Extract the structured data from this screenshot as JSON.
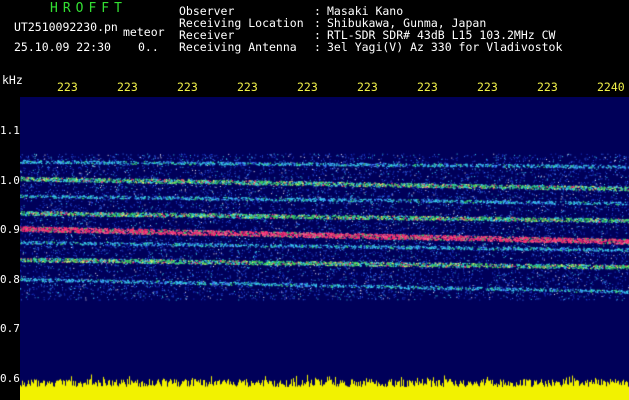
{
  "app": {
    "title": "HROFFT"
  },
  "file": {
    "name": "UT2510092230.pn",
    "type": "meteor"
  },
  "capture": {
    "datetime": "25.10.09 22:30",
    "count": "0.."
  },
  "station": [
    {
      "key": "Observer",
      "value": "Masaki Kano"
    },
    {
      "key": "Receiving Location",
      "value": "Shibukawa, Gunma, Japan"
    },
    {
      "key": "Receiver",
      "value": "RTL-SDR SDR# 43dB L15 103.2MHz CW"
    },
    {
      "key": "Receiving Antenna",
      "value": "3el Yagi(V) Az 330 for Vladivostok"
    }
  ],
  "axis": {
    "y_unit": "kHz",
    "y_ticks": [
      "1.1",
      "1.0",
      "0.9",
      "0.8",
      "0.7",
      "0.6"
    ],
    "x_ticks": [
      "223",
      "223",
      "223",
      "223",
      "223",
      "223",
      "223",
      "223",
      "223",
      "2240"
    ]
  },
  "colors": {
    "background": "#000000",
    "spectrogram_bg": "#000059",
    "header_text": "#ffffff",
    "title_text": "#33e033",
    "tick_text": "#f2f24a",
    "amplitude": "#f2f200",
    "strong_signal": "#ff2a6e"
  },
  "spectrogram": {
    "freq_range_khz": [
      0.6,
      1.15
    ],
    "lines_khz": [
      {
        "start": 1.04,
        "end": 1.03,
        "strength": 1
      },
      {
        "start": 1.005,
        "end": 0.985,
        "strength": 2
      },
      {
        "start": 0.97,
        "end": 0.955,
        "strength": 1
      },
      {
        "start": 0.935,
        "end": 0.92,
        "strength": 2
      },
      {
        "start": 0.903,
        "end": 0.877,
        "strength": 3
      },
      {
        "start": 0.875,
        "end": 0.86,
        "strength": 1
      },
      {
        "start": 0.84,
        "end": 0.825,
        "strength": 2
      },
      {
        "start": 0.8,
        "end": 0.775,
        "strength": 1
      }
    ]
  }
}
